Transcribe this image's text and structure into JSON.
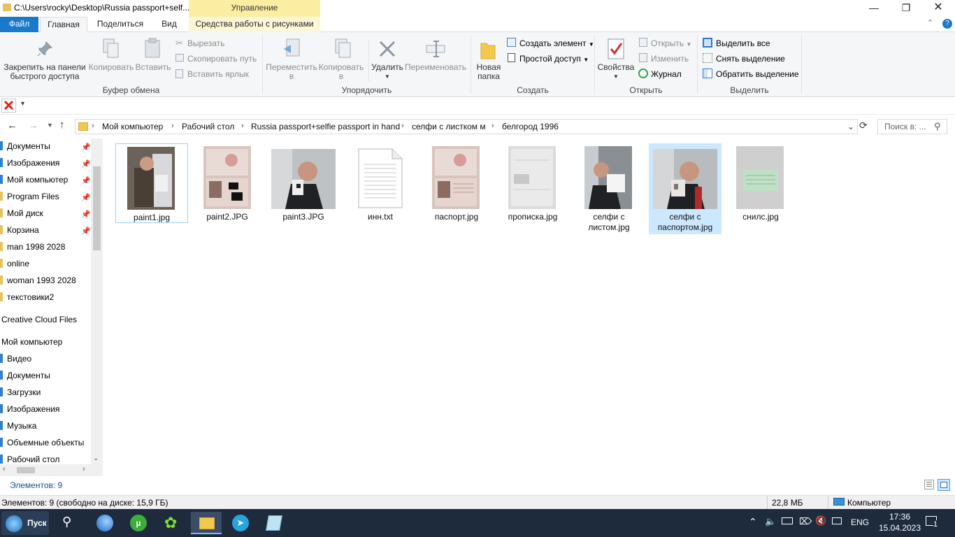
{
  "window": {
    "title": "C:\\Users\\rocky\\Desktop\\Russia passport+self...",
    "context_tab_header": "Управление"
  },
  "ribbon_tabs": [
    "Файл",
    "Главная",
    "Поделиться",
    "Вид",
    "Средства работы с рисунками"
  ],
  "ribbon": {
    "clipboard": {
      "pin_label_1": "Закрепить на панели",
      "pin_label_2": "быстрого доступа",
      "copy": "Копировать",
      "paste": "Вставить",
      "cut": "Вырезать",
      "copy_path": "Скопировать путь",
      "paste_shortcut": "Вставить ярлык",
      "group": "Буфер обмена"
    },
    "organize": {
      "move_1": "Переместить",
      "move_2": "в",
      "copy_to_1": "Копировать",
      "copy_to_2": "в",
      "delete": "Удалить",
      "rename": "Переименовать",
      "group": "Упорядочить"
    },
    "create": {
      "new_folder_1": "Новая",
      "new_folder_2": "папка",
      "new_item": "Создать элемент",
      "easy_access": "Простой доступ",
      "group": "Создать"
    },
    "open": {
      "properties": "Свойства",
      "open": "Открыть",
      "edit": "Изменить",
      "history": "Журнал",
      "group": "Открыть"
    },
    "select": {
      "select_all": "Выделить все",
      "select_none": "Снять выделение",
      "invert": "Обратить выделение",
      "group": "Выделить"
    }
  },
  "breadcrumbs": [
    "Мой компьютер",
    "Рабочий стол",
    "Russia passport+selfie passport in hand",
    "селфи с листком м",
    "белгород 1996"
  ],
  "search_placeholder": "Поиск в: ...",
  "nav_items": [
    {
      "label": "Документы",
      "pinned": true
    },
    {
      "label": "Изображения",
      "pinned": true
    },
    {
      "label": "Мой компьютер",
      "pinned": true
    },
    {
      "label": "Program Files",
      "pinned": true
    },
    {
      "label": "Мой диск",
      "pinned": true
    },
    {
      "label": "Корзина",
      "pinned": true
    },
    {
      "label": "man 1998 2028",
      "pinned": false
    },
    {
      "label": "online",
      "pinned": false
    },
    {
      "label": "woman 1993 2028",
      "pinned": false
    },
    {
      "label": "текстовики2",
      "pinned": false
    },
    {
      "label": "Creative Cloud Files",
      "pinned": false
    },
    {
      "label": "Мой компьютер",
      "pinned": false
    },
    {
      "label": "Видео",
      "pinned": false
    },
    {
      "label": "Документы",
      "pinned": false
    },
    {
      "label": "Загрузки",
      "pinned": false
    },
    {
      "label": "Изображения",
      "pinned": false
    },
    {
      "label": "Музыка",
      "pinned": false
    },
    {
      "label": "Объемные объекты",
      "pinned": false
    },
    {
      "label": "Рабочий стол",
      "pinned": false
    }
  ],
  "files": [
    {
      "line1": "paint1.jpg",
      "line2": "",
      "state": "focused"
    },
    {
      "line1": "paint2.JPG",
      "line2": "",
      "state": "normal"
    },
    {
      "line1": "paint3.JPG",
      "line2": "",
      "state": "normal"
    },
    {
      "line1": "инн.txt",
      "line2": "",
      "state": "normal"
    },
    {
      "line1": "паспорт.jpg",
      "line2": "",
      "state": "normal"
    },
    {
      "line1": "прописка.jpg",
      "line2": "",
      "state": "normal"
    },
    {
      "line1": "селфи с",
      "line2": "листом.jpg",
      "state": "normal"
    },
    {
      "line1": "селфи с",
      "line2": "паспортом.jpg",
      "state": "selected"
    },
    {
      "line1": "снилс.jpg",
      "line2": "",
      "state": "normal"
    }
  ],
  "status": {
    "item_count": "Элементов: 9",
    "bottom_left": "Элементов: 9 (свободно на диске: 15,9 ГБ)",
    "size": "22,8 МБ",
    "location": "Компьютер"
  },
  "taskbar": {
    "start": "Пуск",
    "lang": "ENG",
    "time": "17:36",
    "date": "15.04.2023",
    "notifications": "1"
  },
  "colors": {
    "accent": "#1979ca",
    "context_tab": "#fbeea3",
    "selection": "#cce8ff",
    "taskbar": "#1d2b3d"
  }
}
